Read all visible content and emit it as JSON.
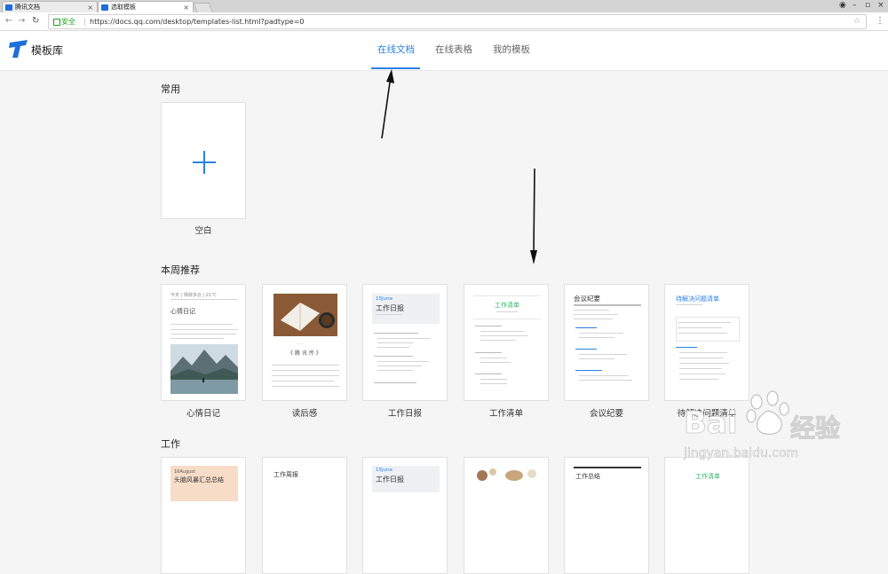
{
  "browser": {
    "tabs": [
      {
        "title": "腾讯文档"
      },
      {
        "title": "选取模板"
      }
    ],
    "address": {
      "secure_label": "安全",
      "url": "https://docs.qq.com/desktop/templates-list.html?padtype=0"
    }
  },
  "header": {
    "brand": "模板库",
    "tabs": [
      {
        "label": "在线文档"
      },
      {
        "label": "在线表格"
      },
      {
        "label": "我的模板"
      }
    ]
  },
  "sections": {
    "common": {
      "title": "常用",
      "cards": [
        {
          "label": "空白"
        }
      ]
    },
    "weekly": {
      "title": "本周推荐",
      "cards": [
        {
          "label": "心情日记",
          "preview_title": "心情日记",
          "preview_header": "今天 | 晴转多云 | 21℃"
        },
        {
          "label": "读后感",
          "preview_title": "《 腾 讯 传 》"
        },
        {
          "label": "工作日报",
          "preview_date": "15June",
          "preview_title": "工作日报"
        },
        {
          "label": "工作清单",
          "preview_title": "工作清单"
        },
        {
          "label": "会议纪要",
          "preview_title": "会议纪要"
        },
        {
          "label": "待解决问题清单",
          "preview_title": "待解决问题清单"
        }
      ]
    },
    "work": {
      "title": "工作",
      "cards": [
        {
          "preview_date": "16August",
          "preview_title": "头脑风暴汇总总结"
        },
        {
          "preview_title": "工作周报"
        },
        {
          "preview_date": "15June",
          "preview_title": "工作日报"
        },
        {},
        {
          "preview_title": "工作总结"
        },
        {
          "preview_title": "工作清单"
        }
      ]
    }
  },
  "watermark": {
    "text": "Bai",
    "text2": "经验",
    "url": "jingyan.baidu.com"
  },
  "colors": {
    "accent": "#2a82e4",
    "page_bg": "#f5f5f5"
  }
}
